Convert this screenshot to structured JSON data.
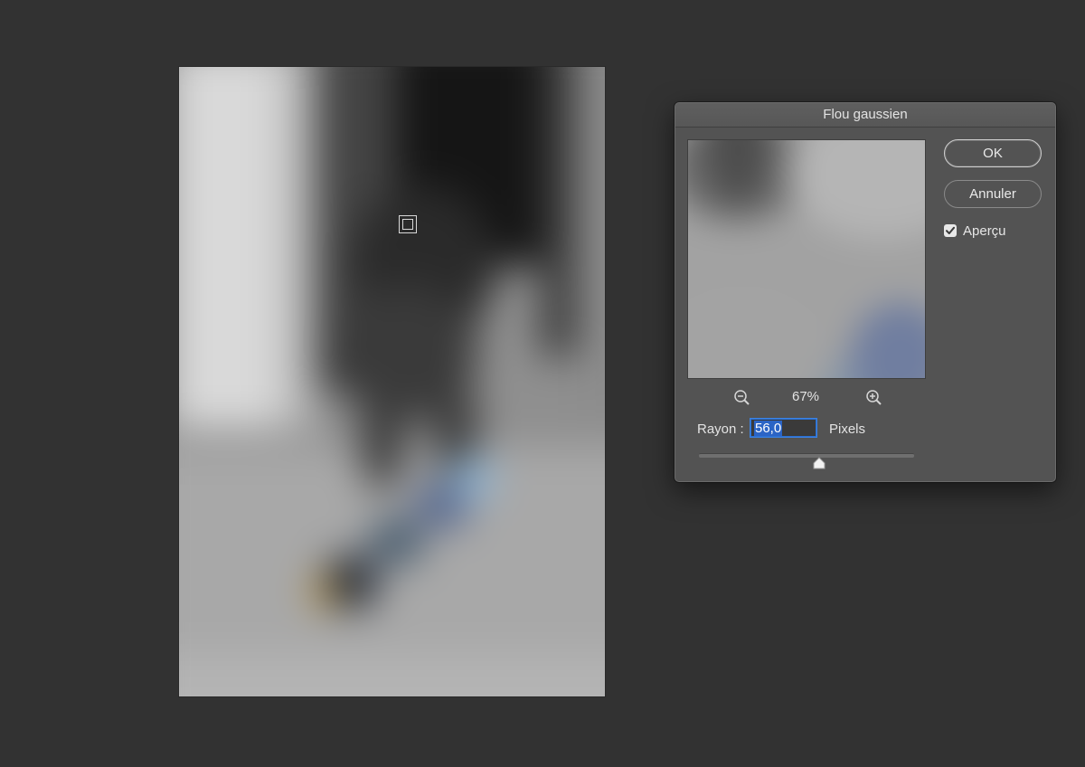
{
  "dialog": {
    "title": "Flou gaussien",
    "ok_label": "OK",
    "cancel_label": "Annuler",
    "preview_checkbox": {
      "label": "Aperçu",
      "checked": true
    },
    "zoom": {
      "value": "67%",
      "zoom_out_icon": "zoom-out-magnifier-icon",
      "zoom_in_icon": "zoom-in-magnifier-icon"
    },
    "radius": {
      "label": "Rayon :",
      "value": "56,0",
      "unit": "Pixels",
      "slider_fraction": 0.56
    }
  },
  "canvas": {
    "preview_marker_icon": "preview-area-marker-icon"
  },
  "colors": {
    "workspace_bg": "#323232",
    "dialog_bg": "#535353",
    "selection_blue": "#2b64c5"
  }
}
